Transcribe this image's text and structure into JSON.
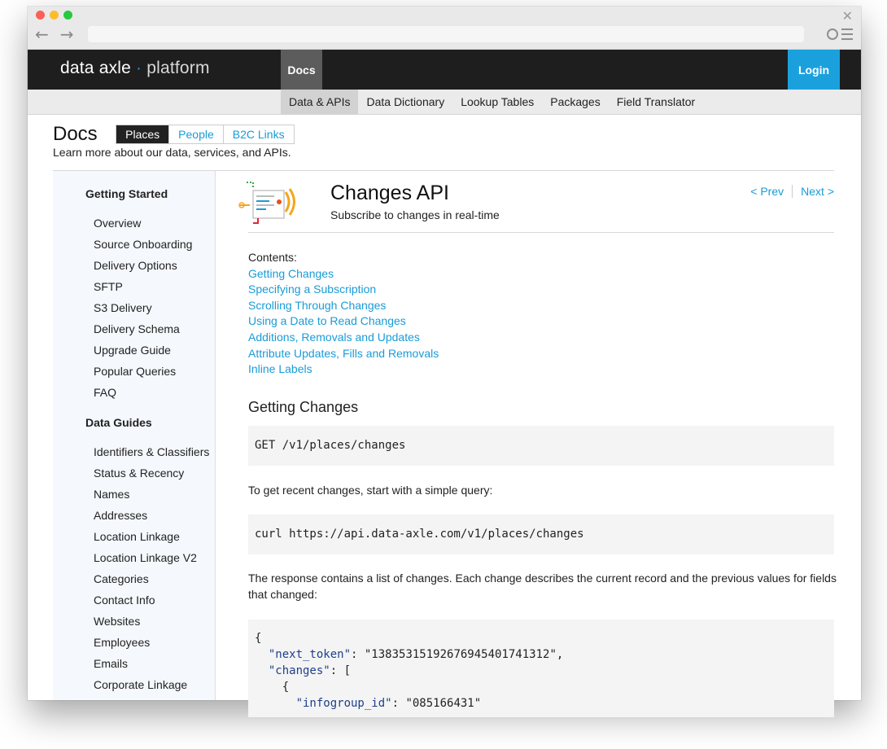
{
  "site": {
    "logo_main": "data axle",
    "logo_sep": "·",
    "logo_platform": "platform",
    "docs_tab": "Docs",
    "login": "Login"
  },
  "subnav": [
    {
      "label": "Data & APIs",
      "active": true
    },
    {
      "label": "Data Dictionary",
      "active": false
    },
    {
      "label": "Lookup Tables",
      "active": false
    },
    {
      "label": "Packages",
      "active": false
    },
    {
      "label": "Field Translator",
      "active": false
    }
  ],
  "docs": {
    "title": "Docs",
    "segments": [
      "Places",
      "People",
      "B2C Links"
    ],
    "active_segment": "Places",
    "subtitle": "Learn more about our data, services, and APIs."
  },
  "sidebar": {
    "groups": [
      {
        "title": "Getting Started",
        "items": [
          "Overview",
          "Source Onboarding",
          "Delivery Options",
          "SFTP",
          "S3 Delivery",
          "Delivery Schema",
          "Upgrade Guide",
          "Popular Queries",
          "FAQ"
        ]
      },
      {
        "title": "Data Guides",
        "items": [
          "Identifiers & Classifiers",
          "Status & Recency",
          "Names",
          "Addresses",
          "Location Linkage",
          "Location Linkage V2",
          "Categories",
          "Contact Info",
          "Websites",
          "Employees",
          "Emails",
          "Corporate Linkage"
        ]
      }
    ]
  },
  "page": {
    "title": "Changes API",
    "subtitle": "Subscribe to changes in real-time",
    "prev": "< Prev",
    "next": "Next >",
    "contents_label": "Contents:",
    "contents": [
      "Getting Changes",
      "Specifying a Subscription",
      "Scrolling Through Changes",
      "Using a Date to Read Changes",
      "Additions, Removals and Updates",
      "Attribute Updates, Fills and Removals",
      "Inline Labels"
    ],
    "section_title": "Getting Changes",
    "code_endpoint": "GET /v1/places/changes",
    "para1": "To get recent changes, start with a simple query:",
    "code_curl": "curl https://api.data-axle.com/v1/places/changes",
    "para2": "The response contains a list of changes. Each change describes the current record and the previous values for fields that changed:",
    "json_sample": {
      "open": "{",
      "key1": "\"next_token\"",
      "val1": ": \"1383531519267694540174131 2\",",
      "key2": "\"changes\"",
      "val2": ": [",
      "open2": "{",
      "key3": "\"infogroup_id\"",
      "val3": ": \"085166431\""
    }
  },
  "colors": {
    "accent": "#1aa1dd",
    "header_bg": "#1e1e1e",
    "sidebar_bg": "#f5f8fc",
    "code_bg": "#f4f4f4"
  }
}
